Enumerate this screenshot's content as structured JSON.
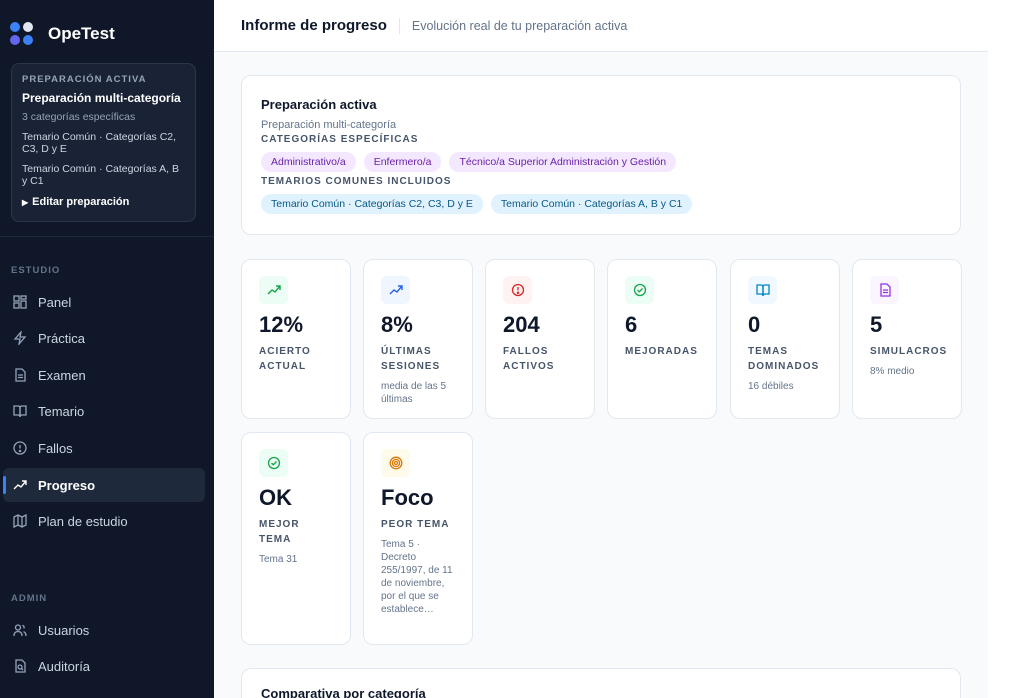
{
  "brand": {
    "name": "OpeTest"
  },
  "sidebar": {
    "prep_card": {
      "eyebrow": "PREPARACIÓN ACTIVA",
      "title": "Preparación multi-categoría",
      "subtitle": "3 categorías específicas",
      "lines": [
        "Temario Común · Categorías C2, C3, D y E",
        "Temario Común · Categorías A, B y C1"
      ],
      "edit_label": "Editar preparación"
    },
    "sections": [
      {
        "label": "ESTUDIO",
        "items": [
          {
            "label": "Panel",
            "icon": "grid-icon"
          },
          {
            "label": "Práctica",
            "icon": "bolt-icon"
          },
          {
            "label": "Examen",
            "icon": "document-icon"
          },
          {
            "label": "Temario",
            "icon": "book-icon"
          },
          {
            "label": "Fallos",
            "icon": "alert-circle-icon"
          },
          {
            "label": "Progreso",
            "icon": "trend-up-icon",
            "active": true
          },
          {
            "label": "Plan de estudio",
            "icon": "map-icon"
          }
        ]
      },
      {
        "label": "ADMIN",
        "items": [
          {
            "label": "Usuarios",
            "icon": "users-icon"
          },
          {
            "label": "Auditoría",
            "icon": "audit-icon"
          }
        ]
      }
    ]
  },
  "header": {
    "title": "Informe de progreso",
    "subtitle": "Evolución real de tu preparación activa"
  },
  "active_prep": {
    "title": "Preparación activa",
    "subtitle": "Preparación multi-categoría",
    "categories_label": "CATEGORÍAS ESPECÍFICAS",
    "categories": [
      "Administrativo/a",
      "Enfermero/a",
      "Técnico/a Superior Administración y Gestión"
    ],
    "common_label": "TEMARIOS COMUNES INCLUIDOS",
    "common": [
      "Temario Común · Categorías C2, C3, D y E",
      "Temario Común · Categorías A, B y C1"
    ]
  },
  "stats": [
    {
      "value": "12%",
      "label": "ACIERTO ACTUAL",
      "note": "",
      "icon": "trend-up-icon",
      "color": "#16a34a",
      "bg": "#ecfdf5"
    },
    {
      "value": "8%",
      "label": "ÚLTIMAS SESIONES",
      "note": "media de las 5 últimas",
      "icon": "trend-up-icon",
      "color": "#2563eb",
      "bg": "#eff6ff"
    },
    {
      "value": "204",
      "label": "FALLOS ACTIVOS",
      "note": "",
      "icon": "alert-circle-icon",
      "color": "#dc2626",
      "bg": "#fef2f2"
    },
    {
      "value": "6",
      "label": "MEJORADAS",
      "note": "",
      "icon": "check-circle-icon",
      "color": "#16a34a",
      "bg": "#ecfdf5"
    },
    {
      "value": "0",
      "label": "TEMAS DOMINADOS",
      "note": "16 débiles",
      "icon": "book-icon",
      "color": "#0284c7",
      "bg": "#f0f9ff"
    },
    {
      "value": "5",
      "label": "SIMULACROS",
      "note": "8% medio",
      "icon": "document-icon",
      "color": "#9333ea",
      "bg": "#faf5ff"
    },
    {
      "value": "OK",
      "label": "MEJOR TEMA",
      "note": "Tema 31",
      "icon": "check-circle-icon",
      "color": "#16a34a",
      "bg": "#ecfdf5"
    },
    {
      "value": "Foco",
      "label": "PEOR TEMA",
      "note": "Tema 5 · Decreto 255/1997, de 11 de noviembre, por el que se establece…",
      "icon": "target-icon",
      "color": "#d97706",
      "bg": "#fffbeb"
    }
  ],
  "comparison": {
    "title": "Comparativa por categoría"
  }
}
